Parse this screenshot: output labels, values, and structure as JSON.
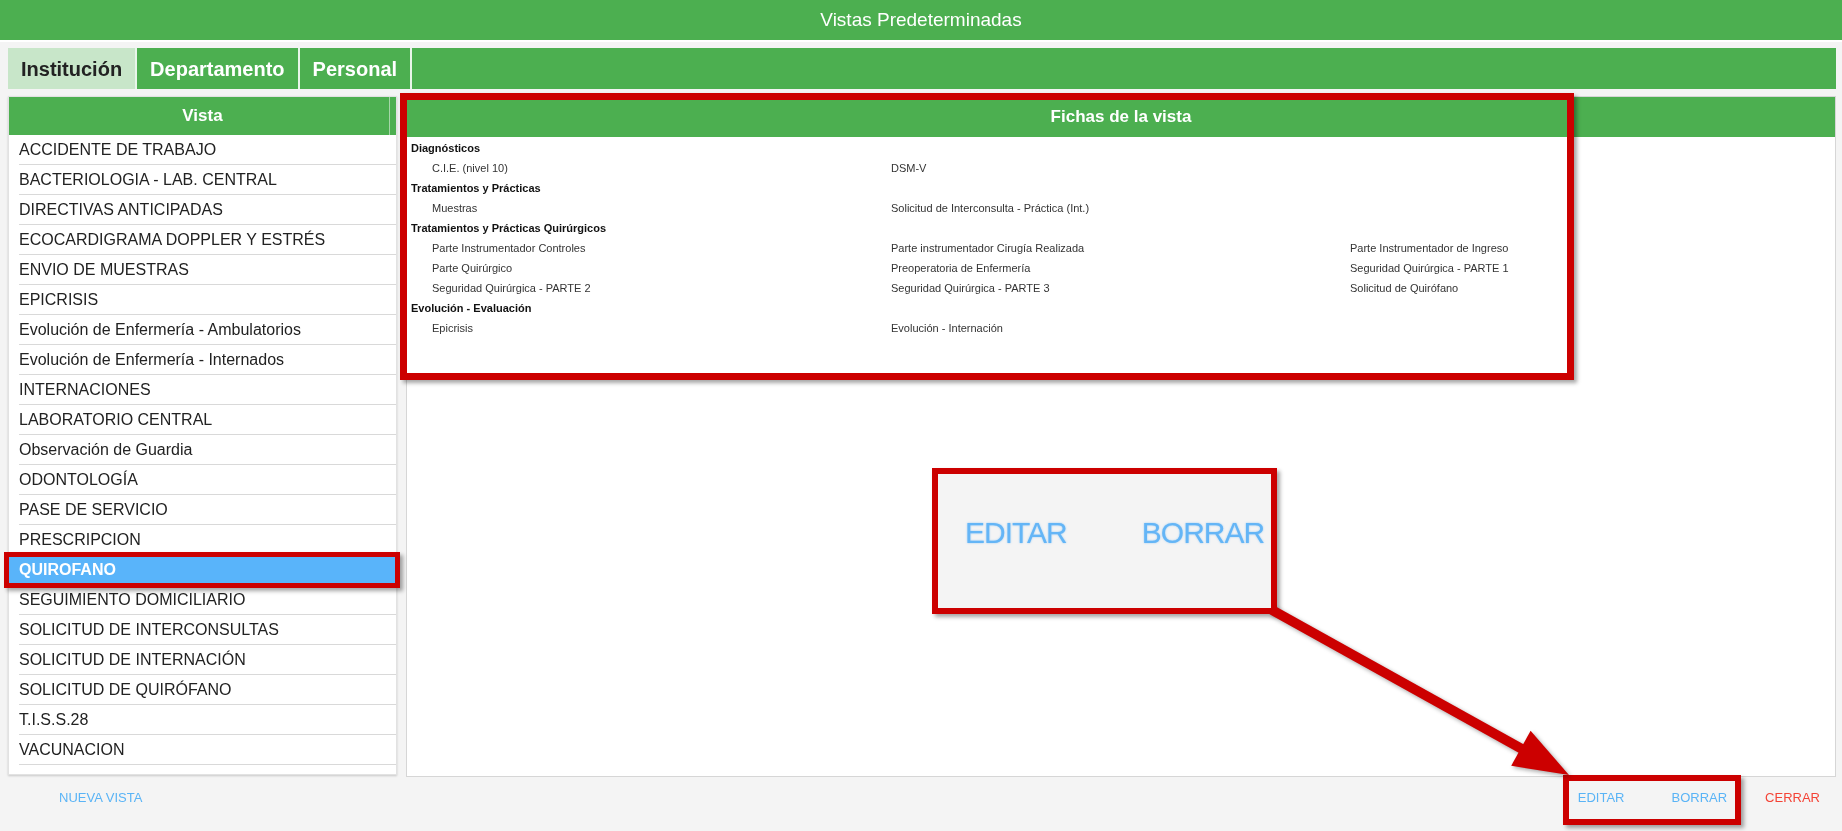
{
  "window": {
    "title": "Vistas Predeterminadas"
  },
  "tabs": [
    {
      "label": "Institución",
      "selected": true
    },
    {
      "label": "Departamento",
      "selected": false
    },
    {
      "label": "Personal",
      "selected": false
    }
  ],
  "vista_list": {
    "header": "Vista",
    "items": [
      {
        "label": "ACCIDENTE DE TRABAJO",
        "selected": false
      },
      {
        "label": "BACTERIOLOGIA - LAB. CENTRAL",
        "selected": false
      },
      {
        "label": "DIRECTIVAS ANTICIPADAS",
        "selected": false
      },
      {
        "label": "ECOCARDIGRAMA DOPPLER Y ESTRÉS",
        "selected": false
      },
      {
        "label": "ENVIO DE MUESTRAS",
        "selected": false
      },
      {
        "label": "EPICRISIS",
        "selected": false
      },
      {
        "label": "Evolución de Enfermería - Ambulatorios",
        "selected": false
      },
      {
        "label": "Evolución de Enfermería - Internados",
        "selected": false
      },
      {
        "label": "INTERNACIONES",
        "selected": false
      },
      {
        "label": "LABORATORIO CENTRAL",
        "selected": false
      },
      {
        "label": "Observación de Guardia",
        "selected": false
      },
      {
        "label": "ODONTOLOGÍA",
        "selected": false
      },
      {
        "label": "PASE DE SERVICIO",
        "selected": false
      },
      {
        "label": "PRESCRIPCION",
        "selected": false
      },
      {
        "label": "QUIROFANO",
        "selected": true
      },
      {
        "label": "SEGUIMIENTO DOMICILIARIO",
        "selected": false
      },
      {
        "label": "SOLICITUD DE INTERCONSULTAS",
        "selected": false
      },
      {
        "label": "SOLICITUD DE INTERNACIÓN",
        "selected": false
      },
      {
        "label": "SOLICITUD DE QUIRÓFANO",
        "selected": false
      },
      {
        "label": "T.I.S.S.28",
        "selected": false
      },
      {
        "label": "VACUNACION",
        "selected": false
      }
    ]
  },
  "fichas": {
    "header": "Fichas de la vista",
    "groups": [
      {
        "title": "Diagnósticos",
        "items": [
          "C.I.E. (nivel 10)",
          "DSM-V"
        ]
      },
      {
        "title": "Tratamientos y Prácticas",
        "items": [
          "Muestras",
          "Solicitud de Interconsulta - Práctica (Int.)"
        ]
      },
      {
        "title": "Tratamientos y Prácticas Quirúrgicos",
        "items": [
          "Parte Instrumentador Controles",
          "Parte instrumentador Cirugía Realizada",
          "Parte Instrumentador de Ingreso",
          "Parte Quirúrgico",
          "Preoperatoria de Enfermería",
          "Seguridad Quirúrgica - PARTE 1",
          "Seguridad Quirúrgica - PARTE 2",
          "Seguridad Quirúrgica - PARTE 3",
          "Solicitud de Quirófano"
        ]
      },
      {
        "title": "Evolución - Evaluación",
        "items": [
          "Epicrisis",
          "Evolución - Internación"
        ]
      }
    ]
  },
  "footer": {
    "left_buttons": [
      {
        "label": "NUEVA VISTA",
        "kind": "primary"
      }
    ],
    "right_buttons": [
      {
        "label": "EDITAR",
        "kind": "primary"
      },
      {
        "label": "BORRAR",
        "kind": "primary"
      },
      {
        "label": "CERRAR",
        "kind": "danger"
      }
    ]
  },
  "callout": {
    "labels": [
      "EDITAR",
      "BORRAR"
    ]
  }
}
